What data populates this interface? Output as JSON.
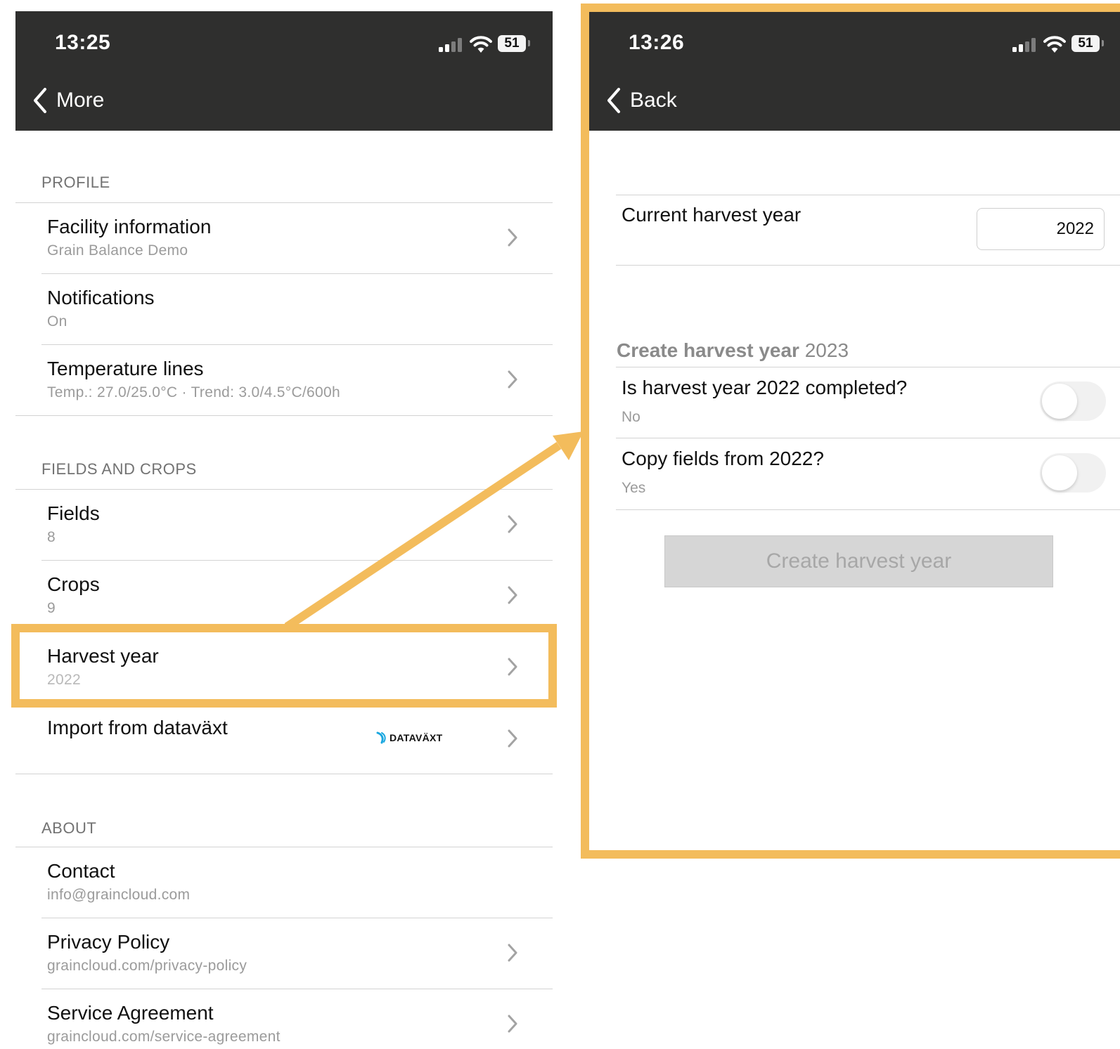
{
  "left_screen": {
    "status_bar": {
      "time": "13:25",
      "battery": "51"
    },
    "nav": {
      "back_label": "More"
    },
    "sections": {
      "profile": "PROFILE",
      "fields_and_crops": "FIELDS AND CROPS",
      "about": "ABOUT"
    },
    "rows": {
      "facility": {
        "title": "Facility information",
        "subtitle": "Grain Balance Demo"
      },
      "notifications": {
        "title": "Notifications",
        "subtitle": "On"
      },
      "temperature": {
        "title": "Temperature lines",
        "subtitle": "Temp.: 27.0/25.0°C · Trend: 3.0/4.5°C/600h"
      },
      "fields": {
        "title": "Fields",
        "subtitle": "8"
      },
      "crops": {
        "title": "Crops",
        "subtitle": "9"
      },
      "harvest": {
        "title": "Harvest year",
        "subtitle": "2022"
      },
      "import": {
        "title": "Import from dataväxt",
        "logo_text": "DATAVÄXT"
      },
      "contact": {
        "title": "Contact",
        "subtitle": "info@graincloud.com"
      },
      "privacy": {
        "title": "Privacy Policy",
        "subtitle": "graincloud.com/privacy-policy"
      },
      "service": {
        "title": "Service Agreement",
        "subtitle": "graincloud.com/service-agreement"
      }
    }
  },
  "right_screen": {
    "status_bar": {
      "time": "13:26",
      "battery": "51"
    },
    "nav": {
      "back_label": "Back"
    },
    "current_year": {
      "label": "Current harvest year",
      "value": "2022"
    },
    "create_section": {
      "header_bold": "Create harvest year",
      "header_year": "2023"
    },
    "completed": {
      "label_pre": "Is harvest year",
      "label_year": "2022",
      "label_post": "completed?",
      "value": "No"
    },
    "copy_fields": {
      "label": "Copy fields from 2022?",
      "value": "Yes"
    },
    "create_button": {
      "label": "Create harvest year"
    }
  },
  "colors": {
    "header_bg": "#2f2f2e",
    "highlight": "#f3bc5c",
    "secondary_text": "#9b9b9b",
    "divider": "#d3d3d3"
  },
  "icons": [
    "signal-icon",
    "wifi-icon",
    "battery-icon",
    "chevron-left-icon",
    "chevron-right-icon",
    "datavaxt-logo"
  ]
}
